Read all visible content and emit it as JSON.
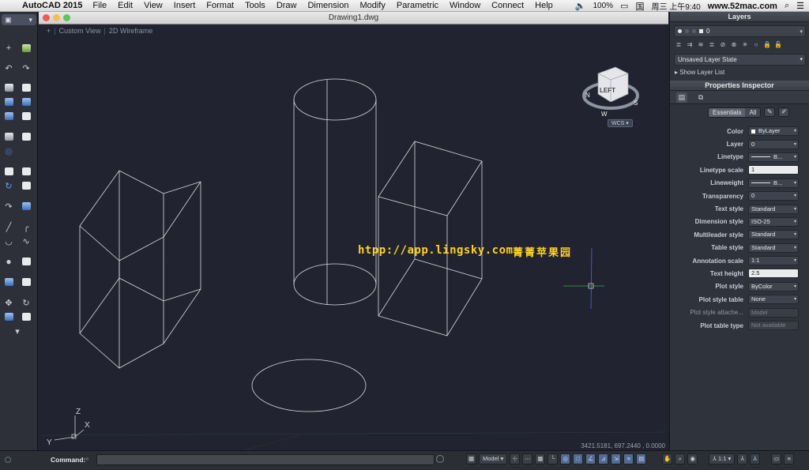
{
  "menubar": {
    "app_name": "AutoCAD 2015",
    "items": [
      "File",
      "Edit",
      "View",
      "Insert",
      "Format",
      "Tools",
      "Draw",
      "Dimension",
      "Modify",
      "Parametric",
      "Window",
      "Connect",
      "Help"
    ],
    "battery": "100%",
    "datetime": "周三 上午9:40",
    "site": "www.52mac.com",
    "input_method": "国"
  },
  "document": {
    "title": "Drawing1.dwg",
    "view_plus": "+",
    "view_name": "Custom View",
    "visual_style": "2D Wireframe",
    "wcs_label": "WCS",
    "viewcube_face": "LEFT",
    "compass": {
      "n": "N",
      "s": "S",
      "w": "W"
    },
    "coordinates": "3421.5181, 697.2440 , 0.0000",
    "watermark_url": "htpp://app.lingsky.com",
    "watermark_cn": "菁菁苹果园",
    "ucs": {
      "x": "X",
      "y": "Y",
      "z": "Z"
    }
  },
  "layers": {
    "title": "Layers",
    "current_layer": "0",
    "layer_state": "Unsaved Layer State",
    "show_list": "Show Layer List"
  },
  "properties": {
    "title": "Properties Inspector",
    "filter_essentials": "Essentials",
    "filter_all": "All",
    "rows": [
      {
        "label": "Color",
        "value": "ByLayer",
        "kind": "select",
        "swatch": true
      },
      {
        "label": "Layer",
        "value": "0",
        "kind": "select"
      },
      {
        "label": "Linetype",
        "value": "B...",
        "kind": "select",
        "line": true
      },
      {
        "label": "Linetype scale",
        "value": "1",
        "kind": "input"
      },
      {
        "label": "Lineweight",
        "value": "B...",
        "kind": "select",
        "line": true
      },
      {
        "label": "Transparency",
        "value": "0",
        "kind": "select"
      },
      {
        "label": "Text style",
        "value": "Standard",
        "kind": "select"
      },
      {
        "label": "Dimension style",
        "value": "ISO-25",
        "kind": "select"
      },
      {
        "label": "Multileader style",
        "value": "Standard",
        "kind": "select"
      },
      {
        "label": "Table style",
        "value": "Standard",
        "kind": "select"
      },
      {
        "label": "Annotation scale",
        "value": "1:1",
        "kind": "select"
      },
      {
        "label": "Text height",
        "value": "2.5",
        "kind": "input"
      },
      {
        "label": "Plot style",
        "value": "ByColor",
        "kind": "select"
      },
      {
        "label": "Plot style table",
        "value": "None",
        "kind": "select"
      },
      {
        "label": "Plot style attache...",
        "value": "Model",
        "kind": "readonly",
        "dim": true
      },
      {
        "label": "Plot table type",
        "value": "Not available",
        "kind": "readonly"
      }
    ]
  },
  "command": {
    "label": "Command:",
    "value": "",
    "caret": "»"
  },
  "status": {
    "model_label": "Model",
    "annotation_scale": "1:1"
  },
  "colors": {
    "canvas": "#212430",
    "wireframe": "#d9dbe0",
    "watermark": "#ffd21e"
  }
}
